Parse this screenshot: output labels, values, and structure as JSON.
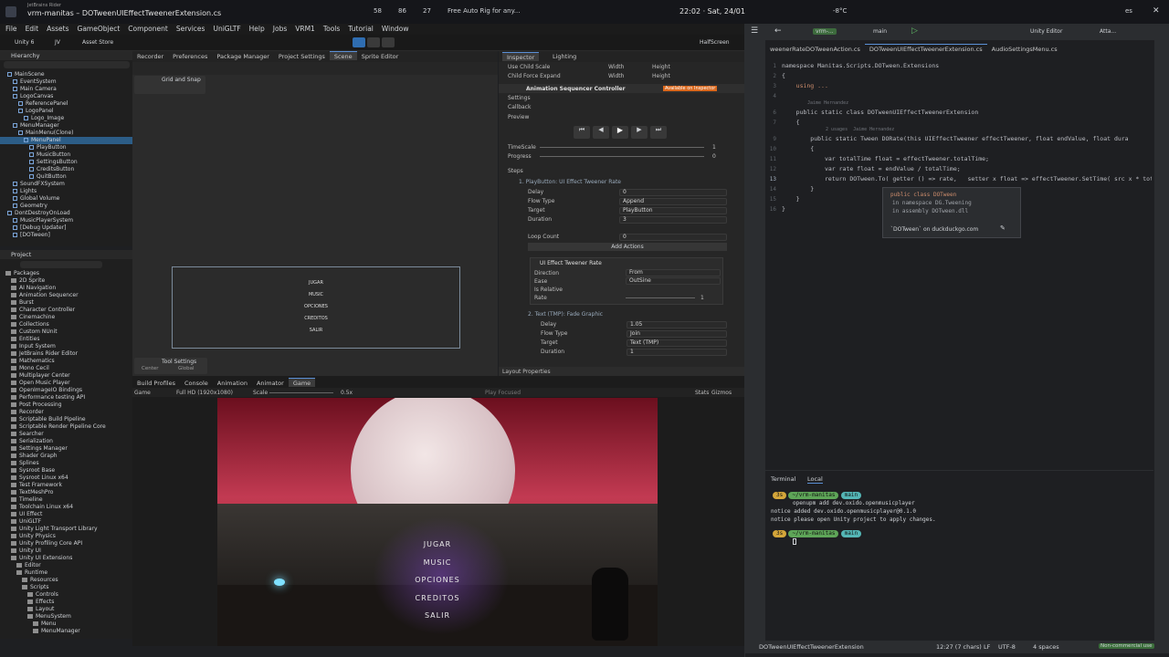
{
  "topbar": {
    "title_small": "JetBrains Rider",
    "title": "vrm-manitas – DOTweenUIEffectTweenerExtension.cs",
    "badge1": "58",
    "badge2": "86",
    "badge3": "27",
    "video_title": "Free Auto Rig for any...",
    "clock": "22:02 · Sat, 24/01",
    "temp": "-8°C",
    "lang": "es"
  },
  "unity": {
    "menu": [
      "File",
      "Edit",
      "Assets",
      "GameObject",
      "Component",
      "Services",
      "UniGLTF",
      "Help",
      "Jobs",
      "VRM1",
      "Tools",
      "Tutorial",
      "Window"
    ],
    "toolbar": {
      "account": "Unity 6",
      "user": "JV",
      "store": "Asset Store",
      "layout": "HalfScreen"
    },
    "scene_tabs": [
      "Recorder",
      "Preferences",
      "Package Manager",
      "Project Settings",
      "Scene",
      "Sprite Editor"
    ],
    "grid_snap": "Grid and Snap",
    "menu_items": [
      "JUGAR",
      "MUSIC",
      "OPCIONES",
      "CREDITOS",
      "SALIR"
    ],
    "tool_settings": "Tool Settings",
    "tool_center": "Center",
    "tool_global": "Global",
    "hierarchy_title": "Hierarchy",
    "hierarchy": [
      "MainScene",
      "EventSystem",
      "Main Camera",
      "LogoCanvas",
      "ReferencePanel",
      "LogoPanel",
      "Logo_Image",
      "MenuManager",
      "MainMenu(Clone)",
      "MenuPanel",
      "PlayButton",
      "MusicButton",
      "SettingsButton",
      "CreditsButton",
      "QuitButton",
      "SoundFXSystem",
      "Lights",
      "Global Volume",
      "Geometry",
      "DontDestroyOnLoad",
      "MusicPlayerSystem",
      "[Debug Updater]",
      "[DOTween]"
    ],
    "project_title": "Project",
    "packages": [
      "Packages",
      "2D Sprite",
      "AI Navigation",
      "Animation Sequencer",
      "Burst",
      "Character Controller",
      "Cinemachine",
      "Collections",
      "Custom NUnit",
      "Entities",
      "Input System",
      "JetBrains Rider Editor",
      "Mathematics",
      "Mono Cecil",
      "Multiplayer Center",
      "Open Music Player",
      "OpenImageIO Bindings",
      "Performance testing API",
      "Post Processing",
      "Recorder",
      "Scriptable Build Pipeline",
      "Scriptable Render Pipeline Core",
      "Searcher",
      "Serialization",
      "Settings Manager",
      "Shader Graph",
      "Splines",
      "Sysroot Base",
      "Sysroot Linux x64",
      "Test Framework",
      "TextMeshPro",
      "Timeline",
      "Toolchain Linux x64",
      "UI Effect",
      "UniGLTF",
      "Unity Light Transport Library",
      "Unity Physics",
      "Unity Profiling Core API",
      "Unity UI",
      "Unity UI Extensions",
      "Editor",
      "Runtime",
      "Resources",
      "Scripts",
      "Controls",
      "Effects",
      "Layout",
      "MenuSystem",
      "Menu",
      "MenuManager"
    ],
    "bottom_tabs": [
      "Build Profiles",
      "Console",
      "Animation",
      "Animator",
      "Game"
    ],
    "game_bar": {
      "display": "Game",
      "res": "Full HD (1920x1080)",
      "scale": "Scale",
      "scale_val": "0.5x",
      "play": "Play Focused",
      "stats": "Stats",
      "gizmos": "Gizmos"
    },
    "inspector": {
      "tabs": [
        "Inspector",
        "Lighting"
      ],
      "top_rows": [
        [
          "Use Child Scale",
          "Width",
          "Height"
        ],
        [
          "Child Force Expand",
          "Width",
          "Height"
        ]
      ],
      "component": "Animation Sequencer Controller",
      "badge": "Available on Inspector",
      "sections": [
        "Settings",
        "Callback",
        "Preview"
      ],
      "timescale": "TimeScale",
      "timescale_val": "1",
      "progress": "Progress",
      "progress_val": "0",
      "steps": "Steps",
      "step1": "1. PlayButton: UI Effect Tweener Rate",
      "delay": "Delay",
      "delay_val": "0",
      "flow": "Flow Type",
      "flow_val": "Append",
      "target": "Target",
      "target_val": "PlayButton",
      "duration": "Duration",
      "duration_val": "3",
      "loop": "Loop Count",
      "loop_val": "0",
      "add_actions": "Add Actions",
      "sub": "UI Effect Tweener Rate",
      "direction": "Direction",
      "direction_val": "From",
      "ease": "Ease",
      "ease_val": "OutSine",
      "relative": "Is Relative",
      "rate": "Rate",
      "rate_val": "1",
      "step2": "2. Text (TMP): Fade Graphic",
      "delay2_val": "1.05",
      "flow2_val": "Join",
      "target2_val": "Text (TMP)",
      "duration2_val": "1",
      "layout_props": "Layout Properties"
    }
  },
  "rider": {
    "branch": "vrm-...",
    "branch2": "main",
    "config": "Unity Editor",
    "attach": "Atta...",
    "tabs": [
      "weenerRateDOTweenAction.cs",
      "DOTweenUIEffectTweenerExtension.cs",
      "AudioSettingsMenu.cs"
    ],
    "code": {
      "l1": "namespace Manitas.Scripts.DOTween.Extensions",
      "l2": "{",
      "l3": "    using ...",
      "author1": "Jaime Hernandez",
      "l6": "    public static class DOTweenUIEffectTweenerExtension",
      "l7": "    {",
      "usages": "2 usages  Jaime Hernandez",
      "l9": "        public static Tween DORate(this UIEffectTweener effectTweener, float endValue, float dura",
      "l10": "        {",
      "l11": "            var totalTime float = effectTweener.totalTime;",
      "l12": "            var rate float = endValue / totalTime;",
      "l13": "            return DOTween.To( getter () => rate,   setter x float => effectTweener.SetTime( src x * tot",
      "l14": "        }",
      "l15": "    }",
      "l16": "}"
    },
    "line_nums": [
      "1",
      "2",
      "3",
      "4",
      "5",
      "6",
      "7",
      "8",
      "9",
      "10",
      "11",
      "12",
      "13",
      "14",
      "15",
      "16"
    ],
    "popup": {
      "l1": "public class DOTween",
      "l2": "in namespace DG.Tweening",
      "l3": "in assembly DOTween.dll",
      "link": "`DOTween` on duckduckgo.com"
    },
    "terminal": {
      "tabs": [
        "Terminal",
        "Local"
      ],
      "p1": "~/vrm-manitas",
      "b1": "main",
      "t1": "3s",
      "c1": "openupm add dev.oxido.openmusicplayer",
      "o1": "notice added dev.oxido.openmusicplayer@0.1.0",
      "o2": "notice please open Unity project to apply changes.",
      "t2": "3s"
    },
    "status": {
      "file": "DOTweenUIEffectTweenerExtension",
      "pos": "12:27 (7 chars)",
      "lf": "LF",
      "enc": "UTF-8",
      "indent": "4 spaces",
      "license": "Non-commercial use"
    }
  }
}
